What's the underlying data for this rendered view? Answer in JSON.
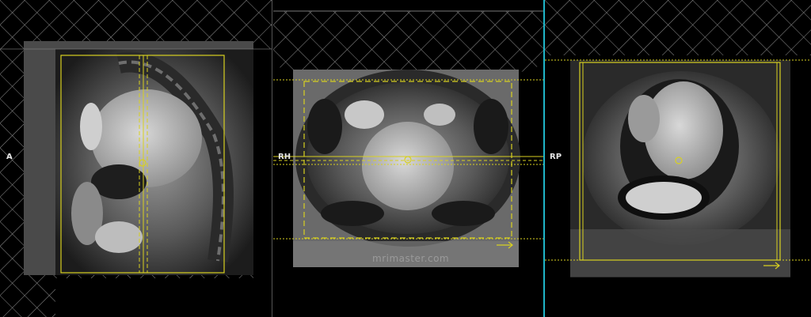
{
  "viewer": {
    "panes": [
      {
        "id": "sagittal",
        "orientation_label": "A"
      },
      {
        "id": "axial",
        "orientation_label": "RH"
      },
      {
        "id": "coronal",
        "orientation_label": "RP"
      }
    ],
    "watermark": "mrimaster.com"
  },
  "colors": {
    "background": "#000000",
    "grid_hatch": "#8a8a8a",
    "planning_box": "#d8d020",
    "active_divider": "#1fb5c8",
    "divider": "#555555"
  },
  "icons": {
    "direction_arrow": "arrow-right-icon",
    "center_marker": "circle-marker-icon"
  }
}
